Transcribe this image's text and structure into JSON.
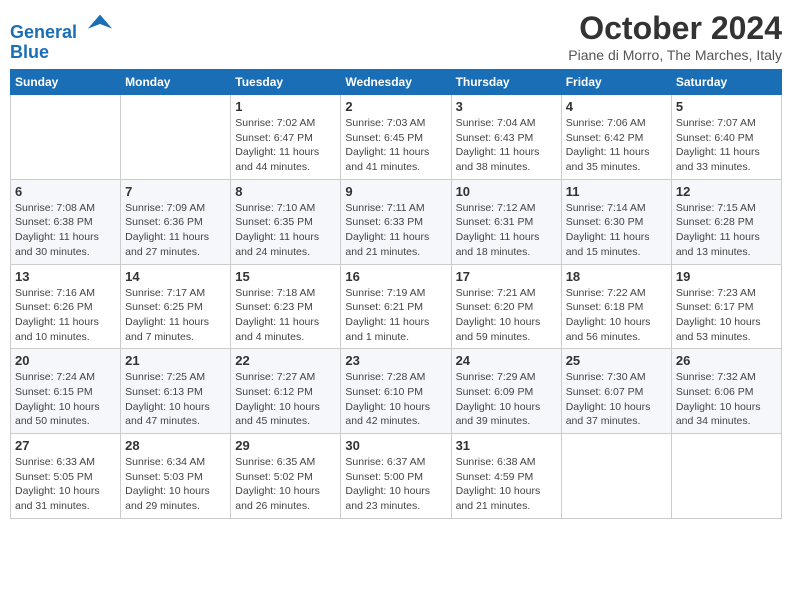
{
  "header": {
    "logo_line1": "General",
    "logo_line2": "Blue",
    "month_title": "October 2024",
    "location": "Piane di Morro, The Marches, Italy"
  },
  "weekdays": [
    "Sunday",
    "Monday",
    "Tuesday",
    "Wednesday",
    "Thursday",
    "Friday",
    "Saturday"
  ],
  "weeks": [
    [
      {
        "day": "",
        "info": ""
      },
      {
        "day": "",
        "info": ""
      },
      {
        "day": "1",
        "info": "Sunrise: 7:02 AM\nSunset: 6:47 PM\nDaylight: 11 hours and 44 minutes."
      },
      {
        "day": "2",
        "info": "Sunrise: 7:03 AM\nSunset: 6:45 PM\nDaylight: 11 hours and 41 minutes."
      },
      {
        "day": "3",
        "info": "Sunrise: 7:04 AM\nSunset: 6:43 PM\nDaylight: 11 hours and 38 minutes."
      },
      {
        "day": "4",
        "info": "Sunrise: 7:06 AM\nSunset: 6:42 PM\nDaylight: 11 hours and 35 minutes."
      },
      {
        "day": "5",
        "info": "Sunrise: 7:07 AM\nSunset: 6:40 PM\nDaylight: 11 hours and 33 minutes."
      }
    ],
    [
      {
        "day": "6",
        "info": "Sunrise: 7:08 AM\nSunset: 6:38 PM\nDaylight: 11 hours and 30 minutes."
      },
      {
        "day": "7",
        "info": "Sunrise: 7:09 AM\nSunset: 6:36 PM\nDaylight: 11 hours and 27 minutes."
      },
      {
        "day": "8",
        "info": "Sunrise: 7:10 AM\nSunset: 6:35 PM\nDaylight: 11 hours and 24 minutes."
      },
      {
        "day": "9",
        "info": "Sunrise: 7:11 AM\nSunset: 6:33 PM\nDaylight: 11 hours and 21 minutes."
      },
      {
        "day": "10",
        "info": "Sunrise: 7:12 AM\nSunset: 6:31 PM\nDaylight: 11 hours and 18 minutes."
      },
      {
        "day": "11",
        "info": "Sunrise: 7:14 AM\nSunset: 6:30 PM\nDaylight: 11 hours and 15 minutes."
      },
      {
        "day": "12",
        "info": "Sunrise: 7:15 AM\nSunset: 6:28 PM\nDaylight: 11 hours and 13 minutes."
      }
    ],
    [
      {
        "day": "13",
        "info": "Sunrise: 7:16 AM\nSunset: 6:26 PM\nDaylight: 11 hours and 10 minutes."
      },
      {
        "day": "14",
        "info": "Sunrise: 7:17 AM\nSunset: 6:25 PM\nDaylight: 11 hours and 7 minutes."
      },
      {
        "day": "15",
        "info": "Sunrise: 7:18 AM\nSunset: 6:23 PM\nDaylight: 11 hours and 4 minutes."
      },
      {
        "day": "16",
        "info": "Sunrise: 7:19 AM\nSunset: 6:21 PM\nDaylight: 11 hours and 1 minute."
      },
      {
        "day": "17",
        "info": "Sunrise: 7:21 AM\nSunset: 6:20 PM\nDaylight: 10 hours and 59 minutes."
      },
      {
        "day": "18",
        "info": "Sunrise: 7:22 AM\nSunset: 6:18 PM\nDaylight: 10 hours and 56 minutes."
      },
      {
        "day": "19",
        "info": "Sunrise: 7:23 AM\nSunset: 6:17 PM\nDaylight: 10 hours and 53 minutes."
      }
    ],
    [
      {
        "day": "20",
        "info": "Sunrise: 7:24 AM\nSunset: 6:15 PM\nDaylight: 10 hours and 50 minutes."
      },
      {
        "day": "21",
        "info": "Sunrise: 7:25 AM\nSunset: 6:13 PM\nDaylight: 10 hours and 47 minutes."
      },
      {
        "day": "22",
        "info": "Sunrise: 7:27 AM\nSunset: 6:12 PM\nDaylight: 10 hours and 45 minutes."
      },
      {
        "day": "23",
        "info": "Sunrise: 7:28 AM\nSunset: 6:10 PM\nDaylight: 10 hours and 42 minutes."
      },
      {
        "day": "24",
        "info": "Sunrise: 7:29 AM\nSunset: 6:09 PM\nDaylight: 10 hours and 39 minutes."
      },
      {
        "day": "25",
        "info": "Sunrise: 7:30 AM\nSunset: 6:07 PM\nDaylight: 10 hours and 37 minutes."
      },
      {
        "day": "26",
        "info": "Sunrise: 7:32 AM\nSunset: 6:06 PM\nDaylight: 10 hours and 34 minutes."
      }
    ],
    [
      {
        "day": "27",
        "info": "Sunrise: 6:33 AM\nSunset: 5:05 PM\nDaylight: 10 hours and 31 minutes."
      },
      {
        "day": "28",
        "info": "Sunrise: 6:34 AM\nSunset: 5:03 PM\nDaylight: 10 hours and 29 minutes."
      },
      {
        "day": "29",
        "info": "Sunrise: 6:35 AM\nSunset: 5:02 PM\nDaylight: 10 hours and 26 minutes."
      },
      {
        "day": "30",
        "info": "Sunrise: 6:37 AM\nSunset: 5:00 PM\nDaylight: 10 hours and 23 minutes."
      },
      {
        "day": "31",
        "info": "Sunrise: 6:38 AM\nSunset: 4:59 PM\nDaylight: 10 hours and 21 minutes."
      },
      {
        "day": "",
        "info": ""
      },
      {
        "day": "",
        "info": ""
      }
    ]
  ]
}
